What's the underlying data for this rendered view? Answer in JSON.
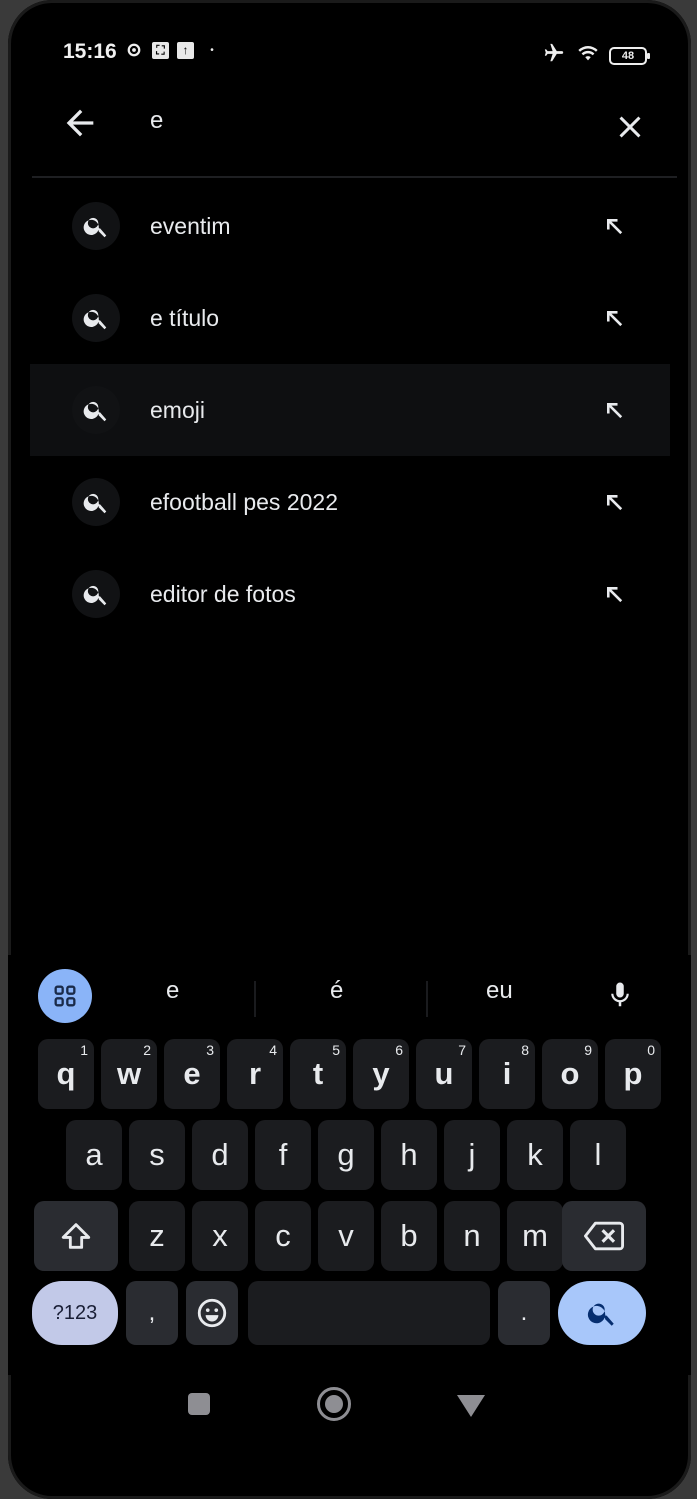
{
  "status_bar": {
    "time": "15:16",
    "battery": "48",
    "icons": [
      "settings-icon",
      "photo-icon",
      "app-icon",
      "dot-icon",
      "airplane-icon",
      "wifi-icon",
      "battery-icon"
    ]
  },
  "search": {
    "query": "e",
    "back_icon": "back-arrow-icon",
    "clear_icon": "close-icon"
  },
  "suggestions": [
    {
      "label": "eventim"
    },
    {
      "label": "e título"
    },
    {
      "label": "emoji"
    },
    {
      "label": "efootball pes 2022"
    },
    {
      "label": "editor de fotos"
    }
  ],
  "keyboard": {
    "candidates": [
      "e",
      "é",
      "eu"
    ],
    "row1": [
      {
        "k": "q",
        "n": "1"
      },
      {
        "k": "w",
        "n": "2"
      },
      {
        "k": "e",
        "n": "3"
      },
      {
        "k": "r",
        "n": "4"
      },
      {
        "k": "t",
        "n": "5"
      },
      {
        "k": "y",
        "n": "6"
      },
      {
        "k": "u",
        "n": "7"
      },
      {
        "k": "i",
        "n": "8"
      },
      {
        "k": "o",
        "n": "9"
      },
      {
        "k": "p",
        "n": "0"
      }
    ],
    "row2": [
      "a",
      "s",
      "d",
      "f",
      "g",
      "h",
      "j",
      "k",
      "l"
    ],
    "row3": [
      "z",
      "x",
      "c",
      "v",
      "b",
      "n",
      "m"
    ],
    "symbols_label": "?123",
    "comma": ",",
    "period": ".",
    "accent": "#8ab4f8"
  }
}
